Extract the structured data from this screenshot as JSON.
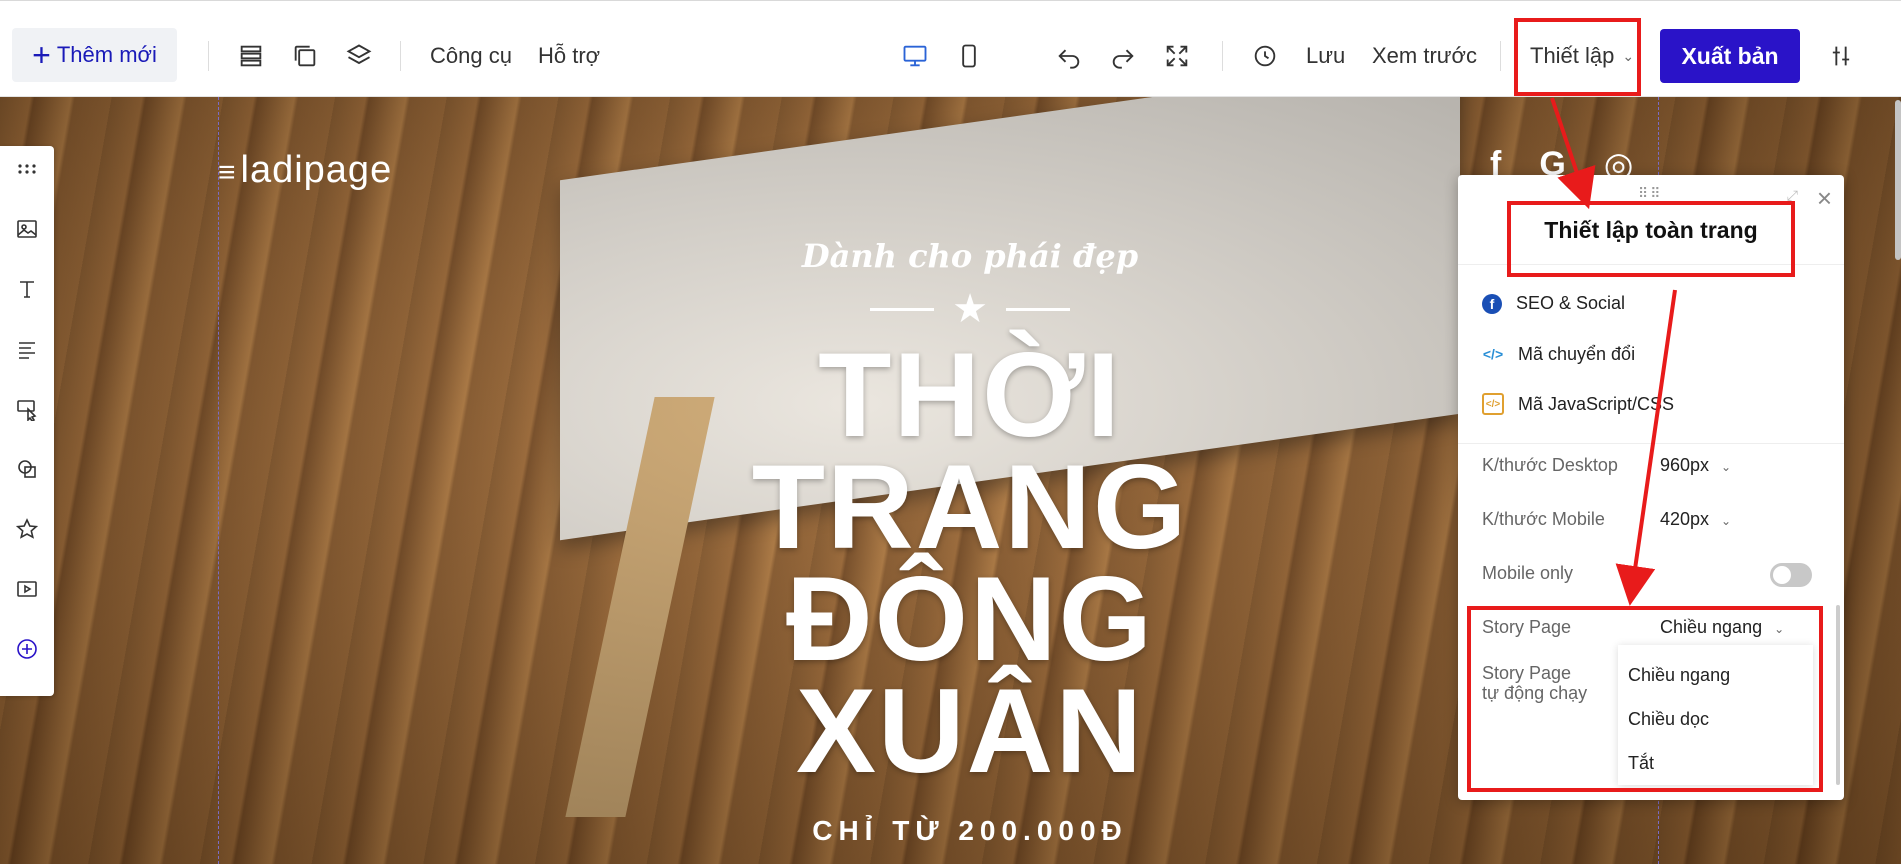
{
  "toolbar": {
    "add_new": "Thêm mới",
    "tools": "Công cụ",
    "support": "Hỗ trợ",
    "save": "Lưu",
    "preview": "Xem trước",
    "settings": "Thiết lập",
    "publish": "Xuất bản",
    "icons": [
      "sections-icon",
      "pages-icon",
      "layers-icon",
      "desktop-icon",
      "mobile-icon",
      "undo-icon",
      "redo-icon",
      "fullscreen-icon",
      "history-icon",
      "adjust-icon"
    ]
  },
  "sidebar": {
    "icons": [
      "drag-handle-icon",
      "image-icon",
      "text-icon",
      "paragraph-icon",
      "cursor-icon",
      "shapes-icon",
      "star-icon",
      "video-icon",
      "add-circle-icon"
    ]
  },
  "canvas": {
    "logo": "ladipage",
    "tagline": "Dành cho phái đẹp",
    "headline": [
      "THỜI",
      "TRANG",
      "ĐÔNG",
      "XUÂN"
    ],
    "subline": "CHỈ TỪ 200.000Đ",
    "social": [
      "f",
      "G",
      "◎"
    ]
  },
  "panel": {
    "title": "Thiết lập toàn trang",
    "links": [
      {
        "label": "SEO & Social",
        "icon": "facebook-icon"
      },
      {
        "label": "Mã chuyển đổi",
        "icon": "code-icon"
      },
      {
        "label": "Mã JavaScript/CSS",
        "icon": "js-css-icon"
      }
    ],
    "desktop_size_label": "K/thước Desktop",
    "desktop_size_value": "960px",
    "mobile_size_label": "K/thước Mobile",
    "mobile_size_value": "420px",
    "mobile_only_label": "Mobile only",
    "mobile_only_on": false,
    "story_page_label": "Story Page",
    "story_page_value": "Chiều ngang",
    "story_auto_label_1": "Story Page",
    "story_auto_label_2": "tự động chạy",
    "dropdown_options": [
      "Chiều ngang",
      "Chiều dọc",
      "Tắt"
    ]
  },
  "colors": {
    "accent": "#2a13c8",
    "highlight": "#e81b1b"
  }
}
